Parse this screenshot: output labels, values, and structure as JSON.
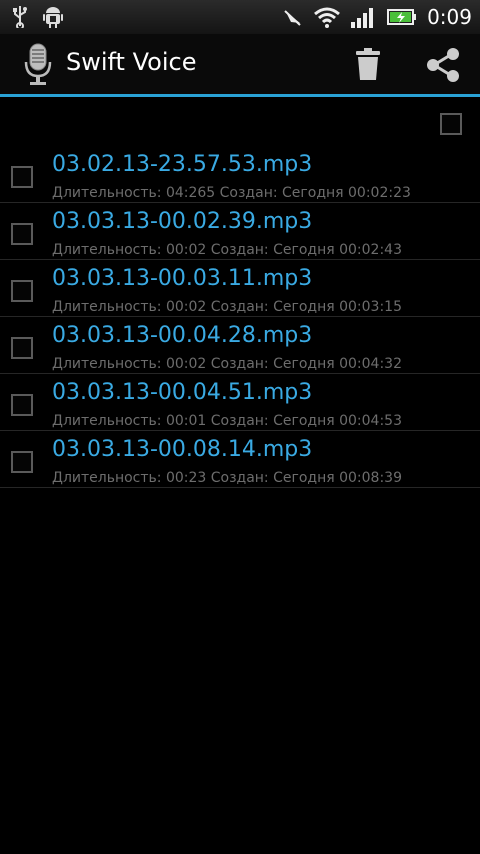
{
  "status_bar": {
    "time": "0:09",
    "icons": [
      "usb-icon",
      "android-debug-icon",
      "mute-icon",
      "wifi-icon",
      "signal-icon",
      "battery-charging-icon"
    ]
  },
  "action_bar": {
    "title": "Swift Voice",
    "icons": [
      "microphone-icon",
      "trash-icon",
      "share-icon"
    ],
    "accent_color": "#2aa2d6"
  },
  "recordings": [
    {
      "filename": "03.02.13-23.57.53.mp3",
      "meta": "Длительность: 04:265 Создан: Сегодня 00:02:23"
    },
    {
      "filename": "03.03.13-00.02.39.mp3",
      "meta": "Длительность: 00:02 Создан: Сегодня 00:02:43"
    },
    {
      "filename": "03.03.13-00.03.11.mp3",
      "meta": "Длительность: 00:02 Создан: Сегодня 00:03:15"
    },
    {
      "filename": "03.03.13-00.04.28.mp3",
      "meta": "Длительность: 00:02 Создан: Сегодня 00:04:32"
    },
    {
      "filename": "03.03.13-00.04.51.mp3",
      "meta": "Длительность: 00:01 Создан: Сегодня 00:04:53"
    },
    {
      "filename": "03.03.13-00.08.14.mp3",
      "meta": "Длительность: 00:23 Создан: Сегодня 00:08:39"
    }
  ],
  "colors": {
    "title_text": "#3aaae3",
    "meta_text": "#6d6d6d",
    "background": "#000000"
  }
}
